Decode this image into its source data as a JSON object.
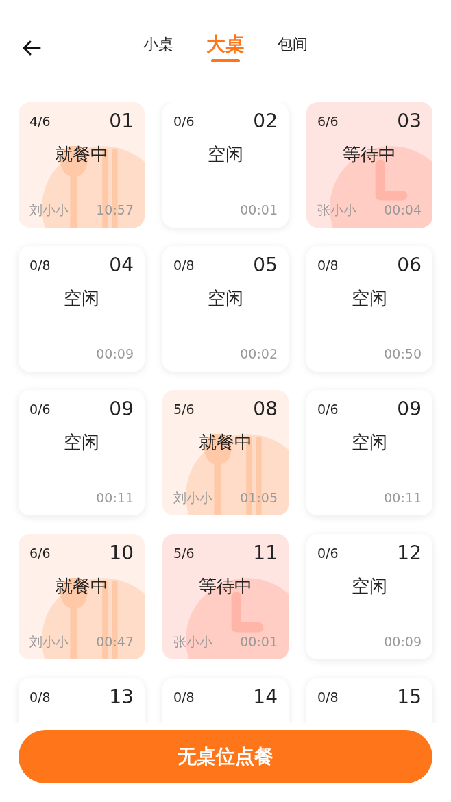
{
  "tabs": [
    {
      "label": "小桌",
      "selected": false
    },
    {
      "label": "大桌",
      "selected": true
    },
    {
      "label": "包间",
      "selected": false
    }
  ],
  "tables": [
    {
      "kind": "dining",
      "seats": "4/6",
      "number": "01",
      "status": "就餐中",
      "person": "刘小小",
      "time": "10:57"
    },
    {
      "kind": "idle",
      "seats": "0/6",
      "number": "02",
      "status": "空闲",
      "time": "00:01"
    },
    {
      "kind": "waiting",
      "seats": "6/6",
      "number": "03",
      "status": "等待中",
      "person": "张小小",
      "time": "00:04"
    },
    {
      "kind": "idle",
      "seats": "0/8",
      "number": "04",
      "status": "空闲",
      "time": "00:09"
    },
    {
      "kind": "idle",
      "seats": "0/8",
      "number": "05",
      "status": "空闲",
      "time": "00:02"
    },
    {
      "kind": "idle",
      "seats": "0/8",
      "number": "06",
      "status": "空闲",
      "time": "00:50"
    },
    {
      "kind": "idle",
      "seats": "0/6",
      "number": "09",
      "status": "空闲",
      "time": "00:11"
    },
    {
      "kind": "dining",
      "seats": "5/6",
      "number": "08",
      "status": "就餐中",
      "person": "刘小小",
      "time": "01:05"
    },
    {
      "kind": "idle",
      "seats": "0/6",
      "number": "09",
      "status": "空闲",
      "time": "00:11"
    },
    {
      "kind": "dining",
      "seats": "6/6",
      "number": "10",
      "status": "就餐中",
      "person": "刘小小",
      "time": "00:47"
    },
    {
      "kind": "waiting",
      "seats": "5/6",
      "number": "11",
      "status": "等待中",
      "person": "张小小",
      "time": "00:01"
    },
    {
      "kind": "idle",
      "seats": "0/6",
      "number": "12",
      "status": "空闲",
      "time": "00:09"
    },
    {
      "kind": "idle",
      "seats": "0/8",
      "number": "13"
    },
    {
      "kind": "idle",
      "seats": "0/8",
      "number": "14"
    },
    {
      "kind": "idle",
      "seats": "0/8",
      "number": "15"
    }
  ],
  "order_button": "无桌位点餐"
}
